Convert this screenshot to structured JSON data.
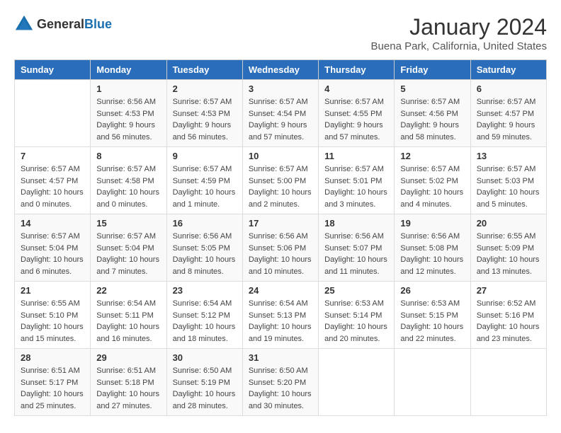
{
  "header": {
    "logo_general": "General",
    "logo_blue": "Blue",
    "title": "January 2024",
    "subtitle": "Buena Park, California, United States"
  },
  "calendar": {
    "days_of_week": [
      "Sunday",
      "Monday",
      "Tuesday",
      "Wednesday",
      "Thursday",
      "Friday",
      "Saturday"
    ],
    "weeks": [
      [
        {
          "day": "",
          "info": ""
        },
        {
          "day": "1",
          "info": "Sunrise: 6:56 AM\nSunset: 4:53 PM\nDaylight: 9 hours\nand 56 minutes."
        },
        {
          "day": "2",
          "info": "Sunrise: 6:57 AM\nSunset: 4:53 PM\nDaylight: 9 hours\nand 56 minutes."
        },
        {
          "day": "3",
          "info": "Sunrise: 6:57 AM\nSunset: 4:54 PM\nDaylight: 9 hours\nand 57 minutes."
        },
        {
          "day": "4",
          "info": "Sunrise: 6:57 AM\nSunset: 4:55 PM\nDaylight: 9 hours\nand 57 minutes."
        },
        {
          "day": "5",
          "info": "Sunrise: 6:57 AM\nSunset: 4:56 PM\nDaylight: 9 hours\nand 58 minutes."
        },
        {
          "day": "6",
          "info": "Sunrise: 6:57 AM\nSunset: 4:57 PM\nDaylight: 9 hours\nand 59 minutes."
        }
      ],
      [
        {
          "day": "7",
          "info": "Sunrise: 6:57 AM\nSunset: 4:57 PM\nDaylight: 10 hours\nand 0 minutes."
        },
        {
          "day": "8",
          "info": "Sunrise: 6:57 AM\nSunset: 4:58 PM\nDaylight: 10 hours\nand 0 minutes."
        },
        {
          "day": "9",
          "info": "Sunrise: 6:57 AM\nSunset: 4:59 PM\nDaylight: 10 hours\nand 1 minute."
        },
        {
          "day": "10",
          "info": "Sunrise: 6:57 AM\nSunset: 5:00 PM\nDaylight: 10 hours\nand 2 minutes."
        },
        {
          "day": "11",
          "info": "Sunrise: 6:57 AM\nSunset: 5:01 PM\nDaylight: 10 hours\nand 3 minutes."
        },
        {
          "day": "12",
          "info": "Sunrise: 6:57 AM\nSunset: 5:02 PM\nDaylight: 10 hours\nand 4 minutes."
        },
        {
          "day": "13",
          "info": "Sunrise: 6:57 AM\nSunset: 5:03 PM\nDaylight: 10 hours\nand 5 minutes."
        }
      ],
      [
        {
          "day": "14",
          "info": "Sunrise: 6:57 AM\nSunset: 5:04 PM\nDaylight: 10 hours\nand 6 minutes."
        },
        {
          "day": "15",
          "info": "Sunrise: 6:57 AM\nSunset: 5:04 PM\nDaylight: 10 hours\nand 7 minutes."
        },
        {
          "day": "16",
          "info": "Sunrise: 6:56 AM\nSunset: 5:05 PM\nDaylight: 10 hours\nand 8 minutes."
        },
        {
          "day": "17",
          "info": "Sunrise: 6:56 AM\nSunset: 5:06 PM\nDaylight: 10 hours\nand 10 minutes."
        },
        {
          "day": "18",
          "info": "Sunrise: 6:56 AM\nSunset: 5:07 PM\nDaylight: 10 hours\nand 11 minutes."
        },
        {
          "day": "19",
          "info": "Sunrise: 6:56 AM\nSunset: 5:08 PM\nDaylight: 10 hours\nand 12 minutes."
        },
        {
          "day": "20",
          "info": "Sunrise: 6:55 AM\nSunset: 5:09 PM\nDaylight: 10 hours\nand 13 minutes."
        }
      ],
      [
        {
          "day": "21",
          "info": "Sunrise: 6:55 AM\nSunset: 5:10 PM\nDaylight: 10 hours\nand 15 minutes."
        },
        {
          "day": "22",
          "info": "Sunrise: 6:54 AM\nSunset: 5:11 PM\nDaylight: 10 hours\nand 16 minutes."
        },
        {
          "day": "23",
          "info": "Sunrise: 6:54 AM\nSunset: 5:12 PM\nDaylight: 10 hours\nand 18 minutes."
        },
        {
          "day": "24",
          "info": "Sunrise: 6:54 AM\nSunset: 5:13 PM\nDaylight: 10 hours\nand 19 minutes."
        },
        {
          "day": "25",
          "info": "Sunrise: 6:53 AM\nSunset: 5:14 PM\nDaylight: 10 hours\nand 20 minutes."
        },
        {
          "day": "26",
          "info": "Sunrise: 6:53 AM\nSunset: 5:15 PM\nDaylight: 10 hours\nand 22 minutes."
        },
        {
          "day": "27",
          "info": "Sunrise: 6:52 AM\nSunset: 5:16 PM\nDaylight: 10 hours\nand 23 minutes."
        }
      ],
      [
        {
          "day": "28",
          "info": "Sunrise: 6:51 AM\nSunset: 5:17 PM\nDaylight: 10 hours\nand 25 minutes."
        },
        {
          "day": "29",
          "info": "Sunrise: 6:51 AM\nSunset: 5:18 PM\nDaylight: 10 hours\nand 27 minutes."
        },
        {
          "day": "30",
          "info": "Sunrise: 6:50 AM\nSunset: 5:19 PM\nDaylight: 10 hours\nand 28 minutes."
        },
        {
          "day": "31",
          "info": "Sunrise: 6:50 AM\nSunset: 5:20 PM\nDaylight: 10 hours\nand 30 minutes."
        },
        {
          "day": "",
          "info": ""
        },
        {
          "day": "",
          "info": ""
        },
        {
          "day": "",
          "info": ""
        }
      ]
    ]
  }
}
